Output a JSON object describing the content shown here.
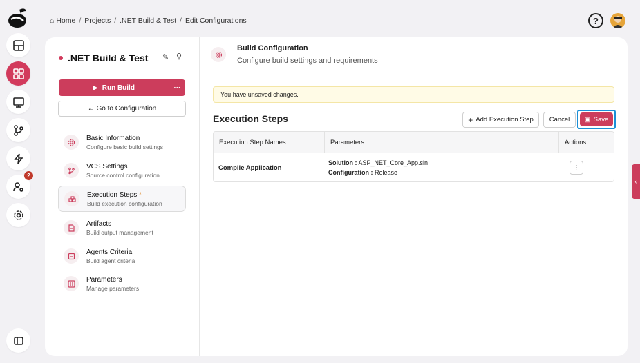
{
  "breadcrumb": [
    "Home",
    "Projects",
    ".NET Build & Test",
    "Edit Configurations"
  ],
  "rail": {
    "items": [
      "dashboard-icon",
      "projects-icon",
      "monitor-icon",
      "branch-icon",
      "lightning-icon",
      "user-settings-icon",
      "gear-icon"
    ],
    "badge_count": "2"
  },
  "header": {
    "help": "?"
  },
  "project": {
    "title": ".NET Build & Test",
    "run_label": "Run Build",
    "run_more": "···",
    "goto_label": "← Go to Configuration"
  },
  "nav": [
    {
      "title": "Basic Information",
      "subtitle": "Configure basic build settings"
    },
    {
      "title": "VCS Settings",
      "subtitle": "Source control configuration"
    },
    {
      "title": "Execution Steps",
      "subtitle": "Build execution configuration",
      "star": "*"
    },
    {
      "title": "Artifacts",
      "subtitle": "Build output management"
    },
    {
      "title": "Agents Criteria",
      "subtitle": "Build agent criteria"
    },
    {
      "title": "Parameters",
      "subtitle": "Manage parameters"
    }
  ],
  "content": {
    "title": "Build Configuration",
    "subtitle": "Configure build settings and requirements",
    "warning": "You have unsaved changes.",
    "steps_title": "Execution Steps",
    "add_label": "Add Execution Step",
    "cancel_label": "Cancel",
    "save_label": "Save",
    "table": {
      "headers": [
        "Execution Step Names",
        "Parameters",
        "Actions"
      ],
      "rows": [
        {
          "name": "Compile Application",
          "solution_key": "Solution :",
          "solution_val": "ASP_NET_Core_App.sln",
          "config_key": "Configuration :",
          "config_val": "Release"
        }
      ]
    }
  },
  "colors": {
    "accent": "#cc3d5c",
    "focus": "#1a8fd6",
    "warning_bg": "#fffbe6"
  }
}
